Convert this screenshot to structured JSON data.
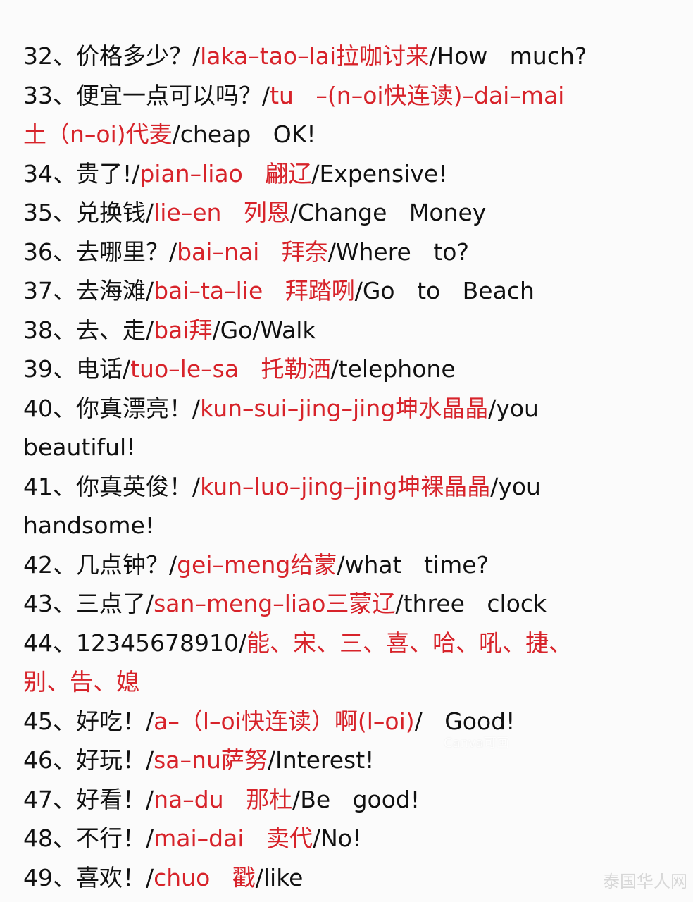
{
  "lines": [
    [
      {
        "t": "32、价格多少？/",
        "red": false
      },
      {
        "t": "laka–tao–lai拉咖讨来",
        "red": true
      },
      {
        "t": "/How   much?",
        "red": false
      }
    ],
    [
      {
        "t": "33、便宜一点可以吗？/",
        "red": false
      },
      {
        "t": "tu   –(n–oi快连读)–dai–mai",
        "red": true
      }
    ],
    [
      {
        "t": "土（n–oi)代麦",
        "red": true
      },
      {
        "t": "/cheap   OK!",
        "red": false
      }
    ],
    [
      {
        "t": "34、贵了!/",
        "red": false
      },
      {
        "t": "pian–liao   翩辽",
        "red": true
      },
      {
        "t": "/Expensive!",
        "red": false
      }
    ],
    [
      {
        "t": "35、兑换钱/",
        "red": false
      },
      {
        "t": "lie–en   列恩",
        "red": true
      },
      {
        "t": "/Change   Money",
        "red": false
      }
    ],
    [
      {
        "t": "36、去哪里？/",
        "red": false
      },
      {
        "t": "bai–nai   拜奈",
        "red": true
      },
      {
        "t": "/Where   to?",
        "red": false
      }
    ],
    [
      {
        "t": "37、去海滩/",
        "red": false
      },
      {
        "t": "bai–ta–lie   拜踏咧",
        "red": true
      },
      {
        "t": "/Go   to   Beach",
        "red": false
      }
    ],
    [
      {
        "t": "38、去、走/",
        "red": false
      },
      {
        "t": "bai拜",
        "red": true
      },
      {
        "t": "/Go/Walk",
        "red": false
      }
    ],
    [
      {
        "t": "39、电话/",
        "red": false
      },
      {
        "t": "tuo–le–sa   托勒洒",
        "red": true
      },
      {
        "t": "/telephone",
        "red": false
      }
    ],
    [
      {
        "t": "40、你真漂亮！/",
        "red": false
      },
      {
        "t": "kun–sui–jing–jing坤水晶晶",
        "red": true
      },
      {
        "t": "/you",
        "red": false
      }
    ],
    [
      {
        "t": "beautiful!",
        "red": false
      }
    ],
    [
      {
        "t": "41、你真英俊！/",
        "red": false
      },
      {
        "t": "kun–luo–jing–jing坤裸晶晶",
        "red": true
      },
      {
        "t": "/you",
        "red": false
      }
    ],
    [
      {
        "t": "handsome!",
        "red": false
      }
    ],
    [
      {
        "t": "42、几点钟？/",
        "red": false
      },
      {
        "t": "gei–meng给蒙",
        "red": true
      },
      {
        "t": "/what   time?",
        "red": false
      }
    ],
    [
      {
        "t": "43、三点了/",
        "red": false
      },
      {
        "t": "san–meng–liao三蒙辽",
        "red": true
      },
      {
        "t": "/three   clock",
        "red": false
      }
    ],
    [
      {
        "t": "44、12345678910/",
        "red": false
      },
      {
        "t": "能、宋、三、喜、哈、吼、捷、",
        "red": true
      }
    ],
    [
      {
        "t": "别、告、媳",
        "red": true
      }
    ],
    [
      {
        "t": "45、好吃！/",
        "red": false
      },
      {
        "t": "a–（l–oi快连读）啊(l–oi)",
        "red": true
      },
      {
        "t": "/   Good!",
        "red": false
      }
    ],
    [
      {
        "t": "46、好玩！/",
        "red": false
      },
      {
        "t": "sa–nu萨努",
        "red": true
      },
      {
        "t": "/Interest!",
        "red": false
      }
    ],
    [
      {
        "t": "47、好看！/",
        "red": false
      },
      {
        "t": "na–du   那杜",
        "red": true
      },
      {
        "t": "/Be   good!",
        "red": false
      }
    ],
    [
      {
        "t": "48、不行！/",
        "red": false
      },
      {
        "t": "mai–dai   卖代",
        "red": true
      },
      {
        "t": "/No!",
        "red": false
      }
    ],
    [
      {
        "t": "49、喜欢！/",
        "red": false
      },
      {
        "t": "chuo   戳",
        "red": true
      },
      {
        "t": "/like",
        "red": false
      }
    ]
  ],
  "watermarks": {
    "center": "Canva可画",
    "corner": "泰国华人网"
  },
  "colors": {
    "text": "#111111",
    "highlight": "#d7232a",
    "background": "#fbfbfb"
  }
}
